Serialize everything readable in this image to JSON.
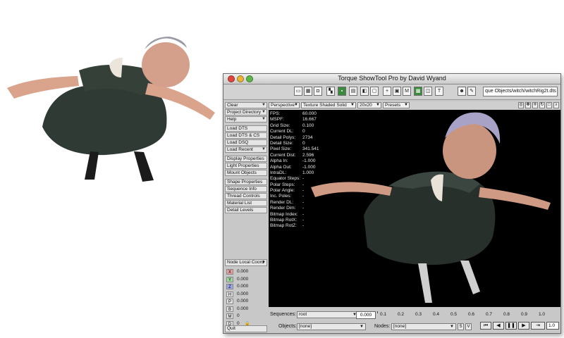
{
  "window": {
    "title": "Torque ShowTool Pro by David Wyand"
  },
  "toolbar": {
    "path_value": "que Objects/witch/witchRig2t.dts",
    "icons": [
      "view-icon",
      "grid-icon",
      "camera-icon",
      "light-icon",
      "green-tool-icon",
      "anim-icon",
      "node-icon",
      "frame-icon",
      "plus-icon",
      "mesh-icon",
      "material-icon",
      "texture-icon",
      "mirror-icon",
      "ts-icon",
      "skin-icon",
      "pen-icon"
    ]
  },
  "sidebar": {
    "items": [
      {
        "label": "Clear",
        "arrow": true
      },
      {
        "label": "Project Directory",
        "arrow": true
      },
      {
        "label": "Help",
        "arrow": true
      },
      {
        "label": "Load DTS",
        "arrow": false
      },
      {
        "label": "Load DTS & CS",
        "arrow": false
      },
      {
        "label": "Load DSQ",
        "arrow": false
      },
      {
        "label": "Load Recent",
        "arrow": true
      },
      {
        "label": "Display Properties",
        "arrow": false
      },
      {
        "label": "Light Properties",
        "arrow": false
      },
      {
        "label": "Mount Objects",
        "arrow": false
      },
      {
        "label": "Shape Properties",
        "arrow": false
      },
      {
        "label": "Sequence Info",
        "arrow": false
      },
      {
        "label": "Thread Controls",
        "arrow": false
      },
      {
        "label": "Material List",
        "arrow": false
      },
      {
        "label": "Detail Levels",
        "arrow": false
      }
    ],
    "coord_mode": "Node Local Coord",
    "coords": [
      {
        "key": "X",
        "value": "0.000",
        "color": "#e8a0a0"
      },
      {
        "key": "Y",
        "value": "0.000",
        "color": "#9fd89f"
      },
      {
        "key": "Z",
        "value": "0.000",
        "color": "#a0a8e8"
      },
      {
        "key": "H",
        "value": "0.000",
        "color": "#e2e2e2"
      },
      {
        "key": "P",
        "value": "0.000",
        "color": "#e2e2e2"
      },
      {
        "key": "B",
        "value": "0.000",
        "color": "#e2e2e2"
      },
      {
        "key": "M",
        "value": "0",
        "color": "#e2e2e2"
      },
      {
        "key": "D",
        "value": "0",
        "color": "#e2e2e2"
      }
    ],
    "quit_label": "Quit"
  },
  "viewbar": {
    "view_mode": "Perspective",
    "shading": "Texture Shaded Solid",
    "grid": "20x20",
    "presets": "Presets"
  },
  "stats": [
    {
      "label": "FPS:",
      "value": "60.000"
    },
    {
      "label": "MSPF:",
      "value": "16.667"
    },
    {
      "label": "Grid Size:",
      "value": "0.100"
    },
    {
      "label": "Current DL:",
      "value": "0"
    },
    {
      "label": "Detail Polys:",
      "value": "2734"
    },
    {
      "label": "Detail Size:",
      "value": "0"
    },
    {
      "label": "Pixel Size:",
      "value": "341.541"
    },
    {
      "label": "Current Dist:",
      "value": "2.596"
    },
    {
      "label": "Alpha In:",
      "value": "-1.000"
    },
    {
      "label": "Alpha Out:",
      "value": "-1.000"
    },
    {
      "label": "IntraDL:",
      "value": "1.000"
    },
    {
      "label": "Equator Steps:",
      "value": "-"
    },
    {
      "label": "Polar Steps:",
      "value": "-"
    },
    {
      "label": "Polar Angle:",
      "value": "-"
    },
    {
      "label": "Inc. Poles:",
      "value": "-"
    },
    {
      "label": "Render DL:",
      "value": "-"
    },
    {
      "label": "Render Dim:",
      "value": "-"
    },
    {
      "label": "Bitmap Index:",
      "value": "-"
    },
    {
      "label": "Bitmap RotX:",
      "value": "-"
    },
    {
      "label": "Bitmap RotZ:",
      "value": "-"
    }
  ],
  "bottom": {
    "sequences_label": "Sequences:",
    "sequence_value": "root",
    "objects_label": "Objects:",
    "objects_value": "[none]",
    "nodes_label": "Nodes:",
    "nodes_value": "[none]",
    "time_value": "0.000",
    "timeline_ticks": [
      "0.1",
      "0.2",
      "0.3",
      "0.4",
      "0.5",
      "0.6",
      "0.7",
      "0.8",
      "0.9",
      "1.0"
    ],
    "speed_value": "1.0",
    "s_label": "S",
    "v_label": "V"
  }
}
